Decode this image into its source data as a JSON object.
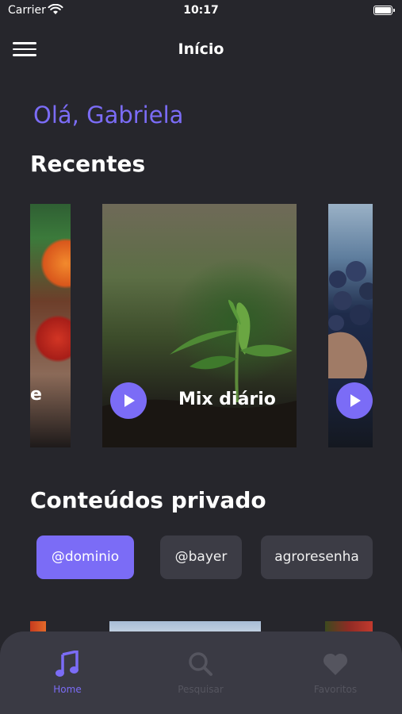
{
  "status_bar": {
    "carrier": "Carrier",
    "time": "10:17"
  },
  "nav": {
    "title": "Início",
    "menu_icon": "hamburger-menu-icon"
  },
  "greeting": "Olá, Gabriela",
  "recent": {
    "title": "Recentes",
    "cards": [
      {
        "label": "e",
        "image": "tomatoes"
      },
      {
        "label": "Mix diário",
        "image": "seedling"
      },
      {
        "label": "",
        "image": "blueberries"
      }
    ]
  },
  "private": {
    "title": "Conteúdos privado",
    "chips": [
      {
        "label": "@dominio",
        "selected": true
      },
      {
        "label": "@bayer",
        "selected": false
      },
      {
        "label": "agroresenha",
        "selected": false
      }
    ]
  },
  "tab_bar": {
    "items": [
      {
        "label": "Home",
        "icon": "music-note-icon",
        "active": true
      },
      {
        "label": "Pesquisar",
        "icon": "search-icon",
        "active": false
      },
      {
        "label": "Favoritos",
        "icon": "heart-icon",
        "active": false
      }
    ]
  },
  "colors": {
    "accent": "#7b6cf6",
    "background": "#26262c",
    "tab_bar": "#3a3a44",
    "chip": "#3c3c45"
  }
}
